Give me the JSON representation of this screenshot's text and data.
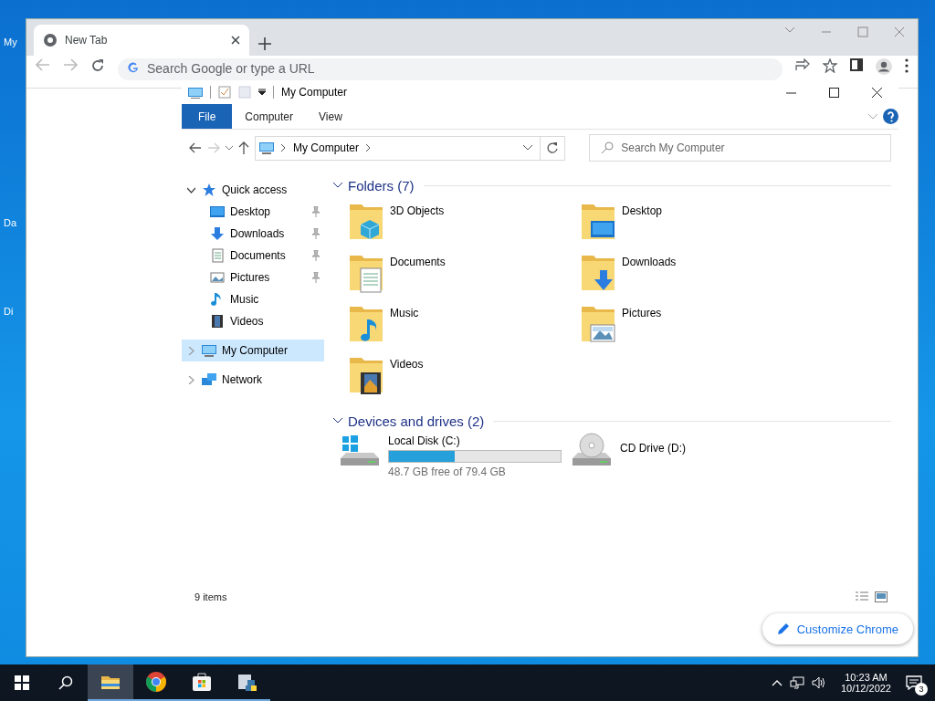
{
  "desktop": {
    "icons": [
      {
        "label": "My"
      },
      {
        "label": "Da"
      },
      {
        "label": "Di"
      }
    ]
  },
  "browser": {
    "tabs": [
      {
        "title": "New Tab",
        "selected": true
      }
    ],
    "omnibox": {
      "placeholder": "Search Google or type a URL"
    },
    "customize_button": "Customize Chrome"
  },
  "explorer": {
    "title": "My Computer",
    "ribbon_tabs": [
      {
        "label": "File",
        "selected": true
      },
      {
        "label": "Computer",
        "selected": false
      },
      {
        "label": "View",
        "selected": false
      }
    ],
    "address": {
      "crumb": "My Computer"
    },
    "search": {
      "placeholder": "Search My Computer"
    },
    "nav": [
      {
        "label": "Quick access",
        "kind": "star",
        "expanded": true,
        "selected": false,
        "children": [
          {
            "label": "Desktop",
            "kind": "desktop",
            "pinned": true
          },
          {
            "label": "Downloads",
            "kind": "download",
            "pinned": true
          },
          {
            "label": "Documents",
            "kind": "document",
            "pinned": true
          },
          {
            "label": "Pictures",
            "kind": "picture",
            "pinned": true
          },
          {
            "label": "Music",
            "kind": "music",
            "pinned": false
          },
          {
            "label": "Videos",
            "kind": "video",
            "pinned": false
          }
        ]
      },
      {
        "label": "My Computer",
        "kind": "computer",
        "expanded": false,
        "selected": true
      },
      {
        "label": "Network",
        "kind": "network",
        "expanded": false,
        "selected": false
      }
    ],
    "folders": {
      "title": "Folders (7)",
      "items": [
        {
          "name": "3D Objects",
          "kind": "cube"
        },
        {
          "name": "Desktop",
          "kind": "desktop"
        },
        {
          "name": "Documents",
          "kind": "document"
        },
        {
          "name": "Downloads",
          "kind": "download"
        },
        {
          "name": "Music",
          "kind": "music"
        },
        {
          "name": "Pictures",
          "kind": "picture"
        },
        {
          "name": "Videos",
          "kind": "video"
        }
      ]
    },
    "drives": {
      "title": "Devices and drives (2)",
      "items": [
        {
          "kind": "disk",
          "name": "Local Disk (C:)",
          "level": 0.385,
          "free": "48.7 GB free of 79.4 GB"
        },
        {
          "kind": "cd",
          "name": "CD Drive (D:)"
        }
      ]
    },
    "status": "9 items"
  },
  "taskbar": {
    "apps": [
      {
        "kind": "explorer",
        "active": true
      },
      {
        "kind": "chrome",
        "active": false
      },
      {
        "kind": "store",
        "active": false
      },
      {
        "kind": "python",
        "active": false
      }
    ],
    "clock": {
      "time": "10:23 AM",
      "date": "10/12/2022"
    },
    "notifications": "3"
  }
}
